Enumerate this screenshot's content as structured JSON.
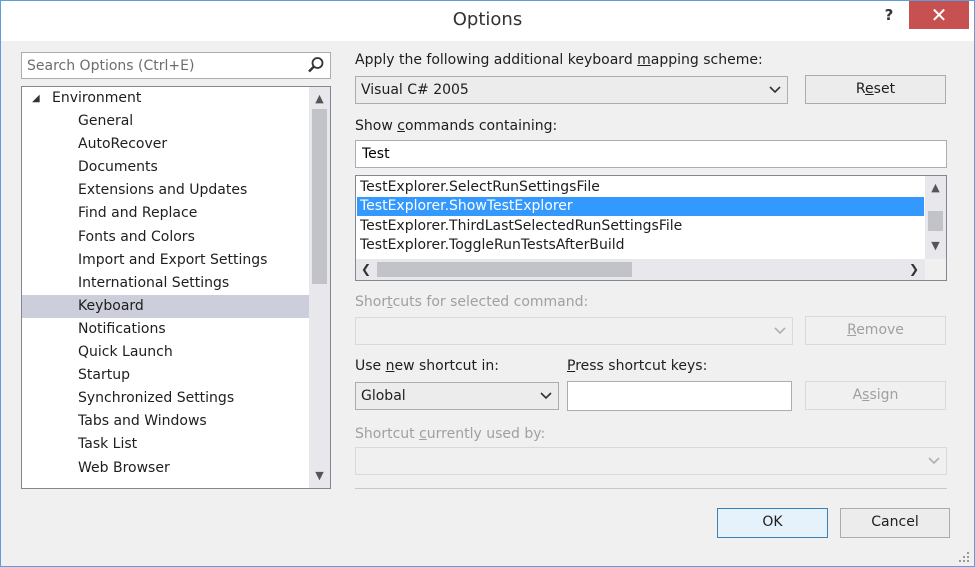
{
  "window": {
    "title": "Options",
    "help_glyph": "?",
    "close_glyph": "✕"
  },
  "search": {
    "placeholder": "Search Options (Ctrl+E)"
  },
  "tree": {
    "root_label": "Environment",
    "items": [
      "General",
      "AutoRecover",
      "Documents",
      "Extensions and Updates",
      "Find and Replace",
      "Fonts and Colors",
      "Import and Export Settings",
      "International Settings",
      "Keyboard",
      "Notifications",
      "Quick Launch",
      "Startup",
      "Synchronized Settings",
      "Tabs and Windows",
      "Task List",
      "Web Browser"
    ],
    "selected": "Keyboard"
  },
  "mapping": {
    "label_pre": "Apply the following additional keyboard ",
    "label_key": "m",
    "label_post": "apping scheme:",
    "value": "Visual C# 2005",
    "reset_pre": "R",
    "reset_key": "e",
    "reset_post": "set"
  },
  "commands": {
    "label_pre": "Show ",
    "label_key": "c",
    "label_post": "ommands containing:",
    "filter_value": "Test",
    "items": [
      "TestExplorer.SelectRunSettingsFile",
      "TestExplorer.ShowTestExplorer",
      "TestExplorer.ThirdLastSelectedRunSettingsFile",
      "TestExplorer.ToggleRunTestsAfterBuild"
    ],
    "selected": "TestExplorer.ShowTestExplorer"
  },
  "shortcuts": {
    "label_pre": "Shor",
    "label_key": "t",
    "label_post": "cuts for selected command:",
    "remove_pre": "",
    "remove_key": "R",
    "remove_post": "emove"
  },
  "new_shortcut": {
    "label_pre": "Use ",
    "label_key": "n",
    "label_post": "ew shortcut in:",
    "scope_value": "Global",
    "press_pre": "",
    "press_key": "P",
    "press_post": "ress shortcut keys:",
    "assign_pre": "A",
    "assign_key": "s",
    "assign_post": "sign"
  },
  "used_by": {
    "label_pre": "Shortcut ",
    "label_key": "c",
    "label_post": "urrently used by:"
  },
  "footer": {
    "ok_label": "OK",
    "cancel_label": "Cancel"
  },
  "colors": {
    "selection": "#3399ff",
    "tree_selection": "#cccedb",
    "close": "#c75050"
  }
}
